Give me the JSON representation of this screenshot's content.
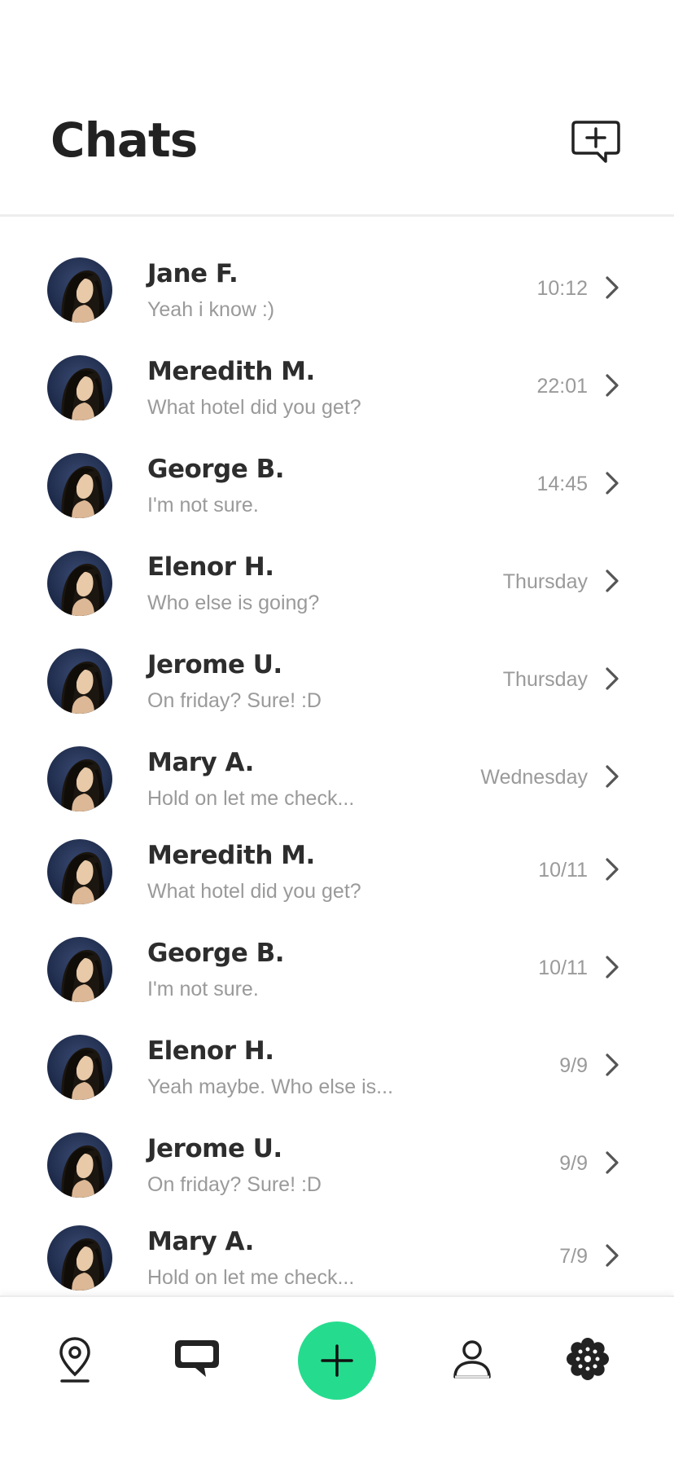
{
  "header": {
    "title": "Chats",
    "new_chat_icon": "new-message-icon"
  },
  "chats": [
    {
      "name": "Jane F.",
      "preview": "Yeah i know :)",
      "time": "10:12"
    },
    {
      "name": "Meredith M.",
      "preview": "What hotel did you get?",
      "time": "22:01"
    },
    {
      "name": "George B.",
      "preview": "I'm not sure.",
      "time": "14:45"
    },
    {
      "name": "Elenor H.",
      "preview": "Who else is going?",
      "time": "Thursday"
    },
    {
      "name": "Jerome U.",
      "preview": "On friday? Sure! :D",
      "time": "Thursday"
    },
    {
      "name": "Mary A.",
      "preview": "Hold on let me check...",
      "time": "Wednesday"
    },
    {
      "name": "Meredith M.",
      "preview": "What hotel did you get?",
      "time": "10/11"
    },
    {
      "name": "George B.",
      "preview": "I'm not sure.",
      "time": "10/11"
    },
    {
      "name": "Elenor H.",
      "preview": "Yeah maybe. Who else is...",
      "time": "9/9"
    },
    {
      "name": "Jerome U.",
      "preview": "On friday? Sure! :D",
      "time": "9/9"
    },
    {
      "name": "Mary A.",
      "preview": "Hold on let me check...",
      "time": "7/9"
    }
  ],
  "tab_bar": {
    "items": [
      "map-pin-icon",
      "chat-bubble-icon",
      "plus-icon",
      "profile-icon",
      "settings-icon"
    ],
    "active": "chat-bubble-icon",
    "accent_color": "#25dc8e"
  },
  "colors": {
    "text_primary": "#2d2d2d",
    "text_secondary": "#9a9a9a",
    "divider": "#ededed"
  }
}
